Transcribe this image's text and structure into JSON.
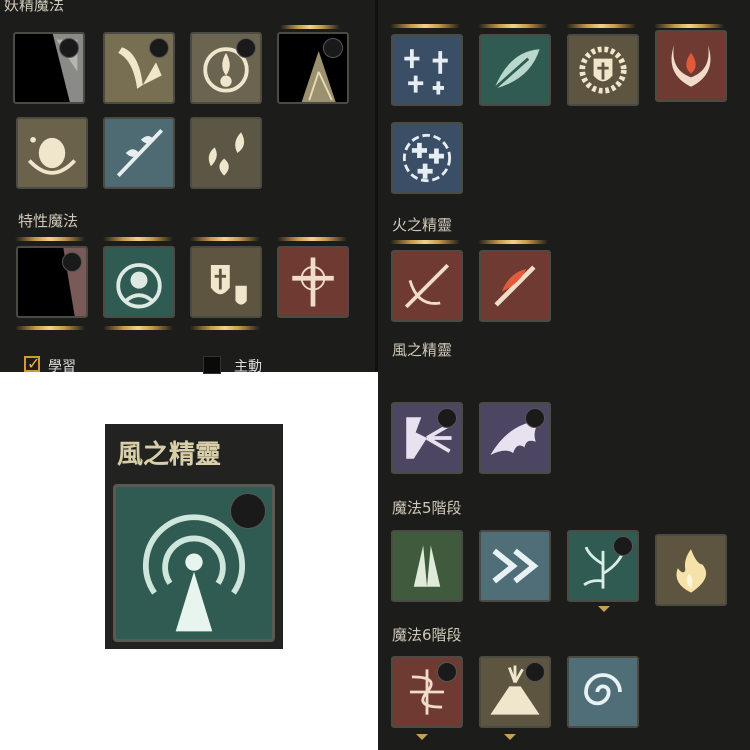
{
  "sections": {
    "fairy_magic": "妖精魔法",
    "trait_magic": "特性魔法",
    "fire_spirit": "火之精靈",
    "wind_spirit": "風之精靈",
    "magic_tier5": "魔法5階段",
    "magic_tier6": "魔法6階段"
  },
  "filters": {
    "learned_label": "學習",
    "active_label": "主動",
    "learned_checked": true
  },
  "zoom": {
    "title": "風之精靈",
    "icon": "wind-tunnel-icon"
  },
  "colors": {
    "panel_bg": "#1c1d1b",
    "gold": "#c79a47",
    "teal": "#2f5b52",
    "blue": "#3a4e66",
    "red": "#6e3a32",
    "purple": "#4d4662",
    "tan": "#5e5540"
  },
  "icons": {
    "fairy_magic": [
      "hidden-skill-icon",
      "feather-slash-icon",
      "spirit-orb-icon",
      "hidden-tree-icon",
      "fairy-circle-icon",
      "vine-spear-icon",
      "elemental-flames-icon"
    ],
    "trait_magic": [
      "hidden-skill-icon",
      "spirit-ring-icon",
      "holy-shields-icon",
      "cross-burst-icon"
    ],
    "right_top": [
      "cross-stars-icon",
      "wind-leaf-icon",
      "sun-shield-icon",
      "fire-horns-icon",
      "circle-crosses-icon"
    ],
    "fire_spirit": [
      "flame-sword-icon",
      "fire-blade-icon"
    ],
    "wind_spirit": [
      "wind-shatter-icon",
      "demon-wings-icon"
    ],
    "magic_tier5": [
      "praying-hands-icon",
      "double-chevron-icon",
      "nature-tree-icon",
      "golden-flame-icon"
    ],
    "magic_tier6": [
      "chaos-rune-icon",
      "volcano-icon",
      "vortex-portal-icon"
    ]
  }
}
